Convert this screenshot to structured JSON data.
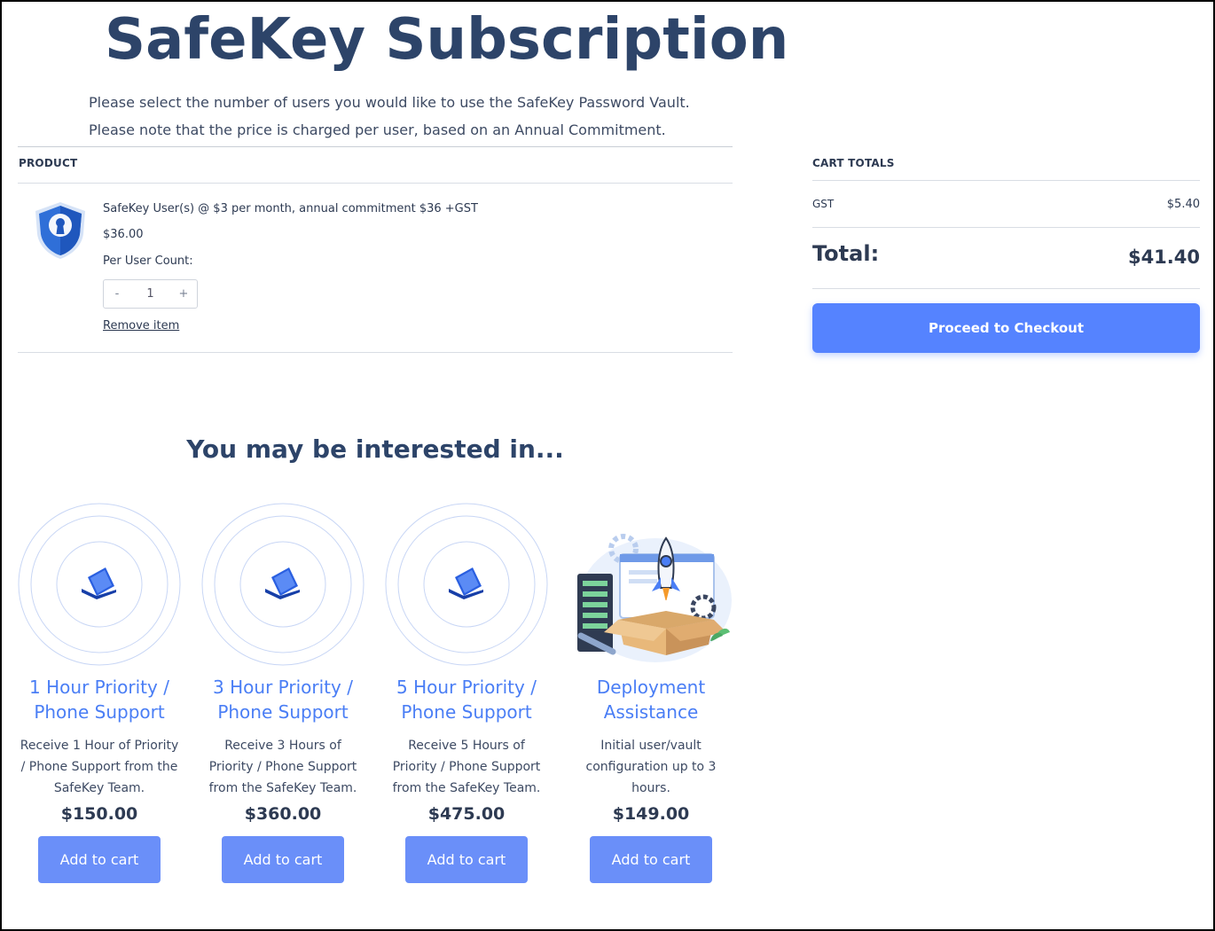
{
  "page": {
    "title": "SafeKey Subscription",
    "intro_line1": "Please select the number of users you would like to use the SafeKey Password Vault.",
    "intro_line2": "Please note that the price is charged per user, based on an Annual Commitment."
  },
  "cart": {
    "product_header": "PRODUCT",
    "item": {
      "name": "SafeKey User(s) @ $3 per month, annual commitment $36 +GST",
      "price": "$36.00",
      "count_label": "Per User Count:",
      "minus": "-",
      "quantity": "1",
      "plus": "+",
      "remove_label": "Remove item",
      "icon": "shield-keyhole-icon"
    }
  },
  "totals": {
    "header": "CART TOTALS",
    "gst_label": "GST",
    "gst_value": "$5.40",
    "total_label": "Total:",
    "total_value": "$41.40",
    "checkout_label": "Proceed to Checkout"
  },
  "upsell": {
    "heading": "You may be interested in...",
    "products": [
      {
        "title": "1 Hour Priority / Phone Support",
        "description": "Receive 1 Hour of Priority / Phone Support from the SafeKey Team.",
        "price": "$150.00",
        "button": "Add to cart",
        "image": "laptop-icon"
      },
      {
        "title": "3 Hour Priority / Phone Support",
        "description": "Receive 3 Hours of Priority / Phone Support from the SafeKey Team.",
        "price": "$360.00",
        "button": "Add to cart",
        "image": "laptop-icon"
      },
      {
        "title": "5 Hour Priority / Phone Support",
        "description": "Receive 5 Hours of Priority / Phone Support from the SafeKey Team.",
        "price": "$475.00",
        "button": "Add to cart",
        "image": "laptop-icon"
      },
      {
        "title": "Deployment Assistance",
        "description": "Initial user/vault configuration up to 3 hours.",
        "price": "$149.00",
        "button": "Add to cart",
        "image": "rocket-box-illustration"
      }
    ]
  },
  "colors": {
    "accent": "#5583ff",
    "button": "#6a8ff9",
    "title": "#2d4469",
    "link_title": "#4a7ef5"
  }
}
